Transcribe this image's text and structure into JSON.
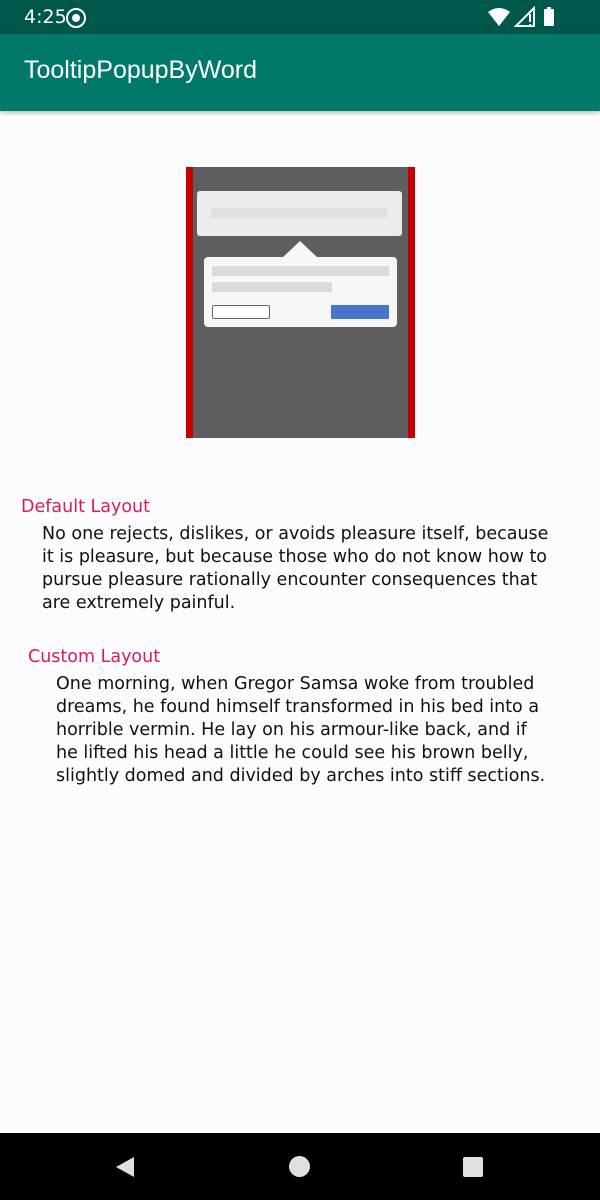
{
  "status_bar": {
    "time": "4:25",
    "icons": [
      "at-sign-icon",
      "wifi-icon",
      "signal-icon",
      "battery-icon"
    ]
  },
  "app_bar": {
    "title": "TooltipPopupByWord",
    "color": "#00796b"
  },
  "sections": {
    "default": {
      "label": "Default Layout",
      "text": "No one rejects, dislikes, or avoids pleasure itself, because it is pleasure, but because those who do not know how to pursue pleasure rationally encounter consequences that are extremely painful."
    },
    "custom": {
      "label": "Custom Layout",
      "text": "One morning, when Gregor Samsa woke from troubled dreams, he found himself transformed in his bed into a horrible vermin. He lay on his armour-like back, and if he lifted his head a little he could see his brown belly, slightly domed and divided by arches into stiff sections."
    }
  },
  "colors": {
    "status_bar": "#00574b",
    "accent": "#d81b60",
    "text": "#111111"
  },
  "nav_bar": {
    "buttons": [
      "back-icon",
      "home-icon",
      "recents-icon"
    ]
  }
}
